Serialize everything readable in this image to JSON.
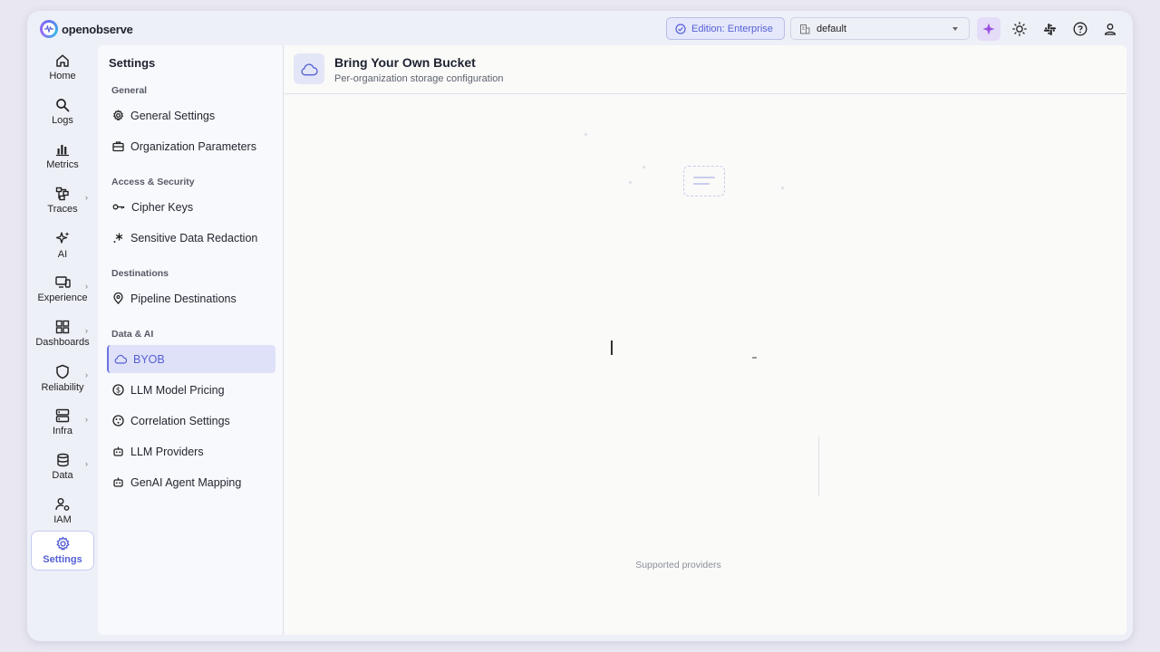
{
  "brand": {
    "name": "openobserve"
  },
  "header": {
    "edition_label": "Edition: Enterprise",
    "org_select_value": "default"
  },
  "rail": {
    "items": [
      {
        "label": "Home",
        "icon": "home-icon"
      },
      {
        "label": "Logs",
        "icon": "search-icon"
      },
      {
        "label": "Metrics",
        "icon": "bar-chart-icon"
      },
      {
        "label": "Traces",
        "icon": "traces-icon"
      },
      {
        "label": "AI",
        "icon": "sparkles-icon"
      },
      {
        "label": "Experience",
        "icon": "monitor-icon"
      },
      {
        "label": "Dashboards",
        "icon": "dashboard-grid-icon"
      },
      {
        "label": "Reliability",
        "icon": "shield-icon"
      },
      {
        "label": "Infra",
        "icon": "server-icon"
      },
      {
        "label": "Data",
        "icon": "database-icon"
      },
      {
        "label": "IAM",
        "icon": "users-gear-icon"
      },
      {
        "label": "Settings",
        "icon": "gear-icon"
      }
    ]
  },
  "settings": {
    "title": "Settings",
    "sections": {
      "general": "General",
      "access": "Access & Security",
      "destinations": "Destinations",
      "data_ai": "Data & AI"
    },
    "items": {
      "general_settings": "General Settings",
      "org_params": "Organization Parameters",
      "cipher_keys": "Cipher Keys",
      "redaction": "Sensitive Data Redaction",
      "pipeline_dest": "Pipeline Destinations",
      "byob": "BYOB",
      "llm_pricing": "LLM Model Pricing",
      "correlation": "Correlation Settings",
      "llm_providers": "LLM Providers",
      "genai_mapping": "GenAI Agent Mapping"
    }
  },
  "content": {
    "title": "Bring Your Own Bucket",
    "subtitle": "Per-organization storage configuration",
    "providers_label": "Supported providers"
  },
  "colors": {
    "accent": "#5660d6",
    "active_bg": "#dee1f8",
    "ai_button_bg": "#e4dcf8"
  }
}
